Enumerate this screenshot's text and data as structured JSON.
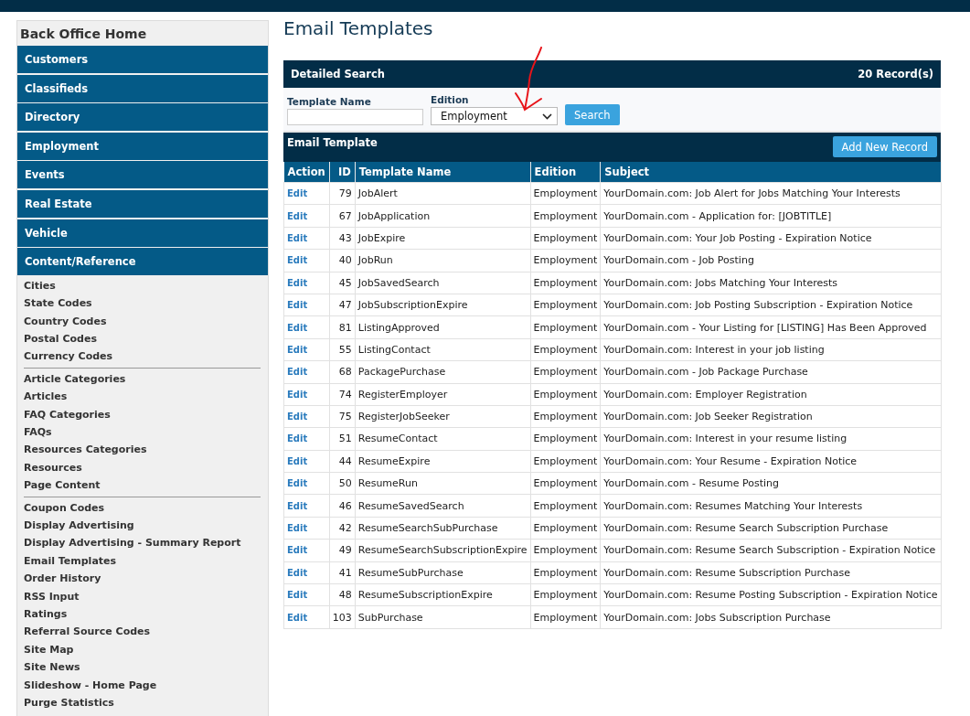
{
  "page": {
    "title": "Email Templates"
  },
  "sidebar": {
    "title": "Back Office Home",
    "nav_items": [
      "Customers",
      "Classifieds",
      "Directory",
      "Employment",
      "Events",
      "Real Estate",
      "Vehicle",
      "Content/Reference"
    ],
    "link_groups": [
      [
        "Cities",
        "State Codes",
        "Country Codes",
        "Postal Codes",
        "Currency Codes"
      ],
      [
        "Article Categories",
        "Articles",
        "FAQ Categories",
        "FAQs",
        "Resources Categories",
        "Resources",
        "Page Content"
      ],
      [
        "Coupon Codes",
        "Display Advertising",
        "Display Advertising - Summary Report",
        "Email Templates",
        "Order History",
        "RSS Input",
        "Ratings",
        "Referral Source Codes",
        "Site Map",
        "Site News",
        "Slideshow - Home Page",
        "Purge Statistics"
      ]
    ]
  },
  "search": {
    "title": "Detailed Search",
    "record_count": "20 Record(s)",
    "template_name_label": "Template Name",
    "edition_label": "Edition",
    "edition_value": "Employment",
    "button": "Search"
  },
  "table": {
    "title": "Email Template",
    "add_button": "Add New Record",
    "columns": [
      "Action",
      "ID",
      "Template Name",
      "Edition",
      "Subject"
    ],
    "rows": [
      {
        "action": "Edit",
        "id": "79",
        "name": "JobAlert",
        "edition": "Employment",
        "subject": "YourDomain.com: Job Alert for Jobs Matching Your Interests"
      },
      {
        "action": "Edit",
        "id": "67",
        "name": "JobApplication",
        "edition": "Employment",
        "subject": "YourDomain.com - Application for: [JOBTITLE]"
      },
      {
        "action": "Edit",
        "id": "43",
        "name": "JobExpire",
        "edition": "Employment",
        "subject": "YourDomain.com: Your Job Posting - Expiration Notice"
      },
      {
        "action": "Edit",
        "id": "40",
        "name": "JobRun",
        "edition": "Employment",
        "subject": "YourDomain.com - Job Posting"
      },
      {
        "action": "Edit",
        "id": "45",
        "name": "JobSavedSearch",
        "edition": "Employment",
        "subject": "YourDomain.com: Jobs Matching Your Interests"
      },
      {
        "action": "Edit",
        "id": "47",
        "name": "JobSubscriptionExpire",
        "edition": "Employment",
        "subject": "YourDomain.com: Job Posting Subscription - Expiration Notice"
      },
      {
        "action": "Edit",
        "id": "81",
        "name": "ListingApproved",
        "edition": "Employment",
        "subject": "YourDomain.com - Your Listing for [LISTING] Has Been Approved"
      },
      {
        "action": "Edit",
        "id": "55",
        "name": "ListingContact",
        "edition": "Employment",
        "subject": "YourDomain.com: Interest in your job listing"
      },
      {
        "action": "Edit",
        "id": "68",
        "name": "PackagePurchase",
        "edition": "Employment",
        "subject": "YourDomain.com - Job Package Purchase"
      },
      {
        "action": "Edit",
        "id": "74",
        "name": "RegisterEmployer",
        "edition": "Employment",
        "subject": "YourDomain.com: Employer Registration"
      },
      {
        "action": "Edit",
        "id": "75",
        "name": "RegisterJobSeeker",
        "edition": "Employment",
        "subject": "YourDomain.com: Job Seeker Registration"
      },
      {
        "action": "Edit",
        "id": "51",
        "name": "ResumeContact",
        "edition": "Employment",
        "subject": "YourDomain.com: Interest in your resume listing"
      },
      {
        "action": "Edit",
        "id": "44",
        "name": "ResumeExpire",
        "edition": "Employment",
        "subject": "YourDomain.com: Your Resume - Expiration Notice"
      },
      {
        "action": "Edit",
        "id": "50",
        "name": "ResumeRun",
        "edition": "Employment",
        "subject": "YourDomain.com - Resume Posting"
      },
      {
        "action": "Edit",
        "id": "46",
        "name": "ResumeSavedSearch",
        "edition": "Employment",
        "subject": "YourDomain.com: Resumes Matching Your Interests"
      },
      {
        "action": "Edit",
        "id": "42",
        "name": "ResumeSearchSubPurchase",
        "edition": "Employment",
        "subject": "YourDomain.com: Resume Search Subscription Purchase"
      },
      {
        "action": "Edit",
        "id": "49",
        "name": "ResumeSearchSubscriptionExpire",
        "edition": "Employment",
        "subject": "YourDomain.com: Resume Search Subscription - Expiration Notice"
      },
      {
        "action": "Edit",
        "id": "41",
        "name": "ResumeSubPurchase",
        "edition": "Employment",
        "subject": "YourDomain.com: Resume Subscription Purchase"
      },
      {
        "action": "Edit",
        "id": "48",
        "name": "ResumeSubscriptionExpire",
        "edition": "Employment",
        "subject": "YourDomain.com: Resume Posting Subscription - Expiration Notice"
      },
      {
        "action": "Edit",
        "id": "103",
        "name": "SubPurchase",
        "edition": "Employment",
        "subject": "YourDomain.com: Jobs Subscription Purchase"
      }
    ]
  }
}
